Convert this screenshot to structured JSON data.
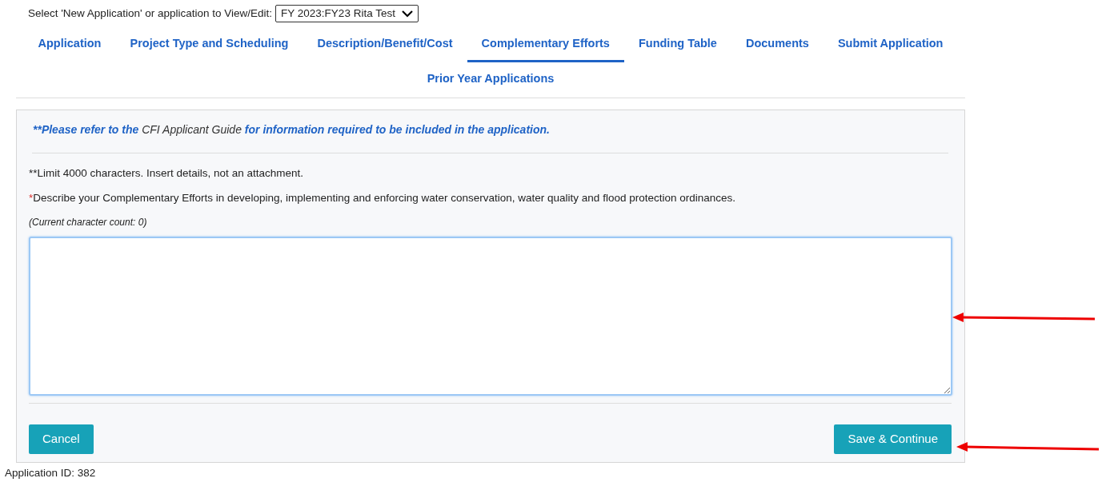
{
  "selector": {
    "label": "Select 'New Application' or application to View/Edit:",
    "value": "FY 2023:FY23 Rita Test"
  },
  "tabs": [
    {
      "label": "Application",
      "selected": false
    },
    {
      "label": "Project Type and Scheduling",
      "selected": false
    },
    {
      "label": "Description/Benefit/Cost",
      "selected": false
    },
    {
      "label": "Complementary Efforts",
      "selected": true
    },
    {
      "label": "Funding Table",
      "selected": false
    },
    {
      "label": "Documents",
      "selected": false
    },
    {
      "label": "Submit Application",
      "selected": false
    },
    {
      "label": "Prior Year Applications",
      "selected": false
    }
  ],
  "notice": {
    "before": "**Please refer to the",
    "link": "CFI Applicant Guide",
    "after": "for information required to be included in the application."
  },
  "limit_note": "**Limit 4000 characters. Insert details, not an attachment.",
  "question": {
    "required": true,
    "marker": "*",
    "text": "Describe your Complementary Efforts in developing, implementing and enforcing water conservation, water quality and flood protection ordinances."
  },
  "char_count": "(Current character count: 0)",
  "answer": {
    "focused": true
  },
  "buttons": {
    "cancel": "Cancel",
    "save": "Save & Continue"
  },
  "footer": "Application ID: 382"
}
